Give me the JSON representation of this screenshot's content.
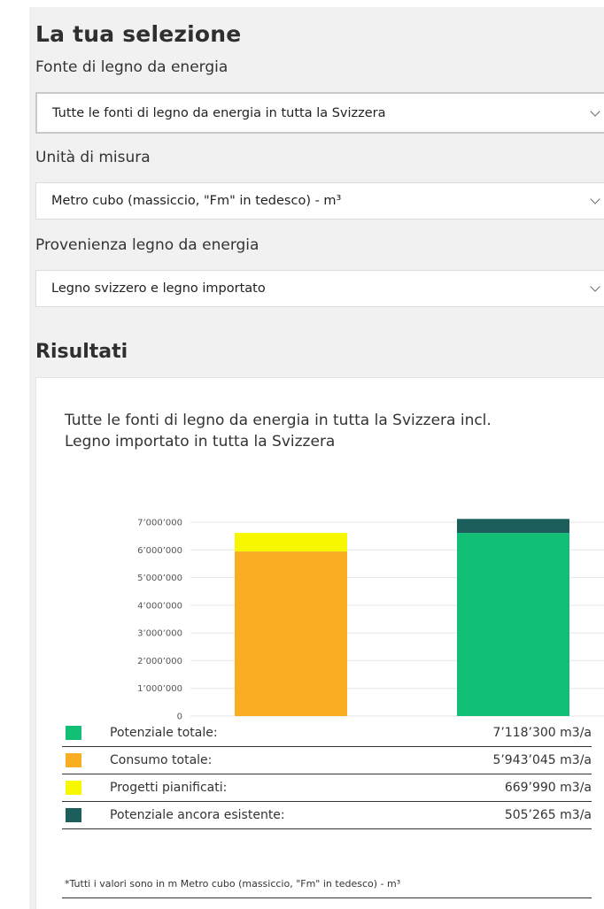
{
  "selection": {
    "title": "La tua selezione",
    "source_label": "Fonte di legno da energia",
    "source_value": "Tutte le fonti di legno da energia in tutta la Svizzera",
    "unit_label": "Unità di misura",
    "unit_value": "Metro cubo (massiccio, \"Fm\" in tedesco) - m³",
    "origin_label": "Provenienza legno da energia",
    "origin_value": "Legno svizzero e legno importato"
  },
  "results": {
    "title": "Risultati",
    "chart_title_line1": "Tutte le fonti di legno da energia in tutta la Svizzera incl.",
    "chart_title_line2": "Legno importato in tutta la Svizzera",
    "legend": [
      {
        "name": "Potenziale totale:",
        "value": "7’118’300 m3/a",
        "color": "#12bf77"
      },
      {
        "name": "Consumo totale:",
        "value": "5’943’045 m3/a",
        "color": "#f9ae21"
      },
      {
        "name": "Progetti pianificati:",
        "value": "669’990 m3/a",
        "color": "#f7f700"
      },
      {
        "name": "Potenziale ancora esistente:",
        "value": "505’265 m3/a",
        "color": "#1b5e5c"
      }
    ],
    "footnote": "*Tutti i valori sono in m Metro cubo (massiccio, \"Fm\" in tedesco) - m³"
  },
  "chart_data": {
    "type": "bar",
    "stacked": true,
    "ylim": [
      0,
      7000000
    ],
    "yticks": [
      "0",
      "1’000’000",
      "2’000’000",
      "3’000’000",
      "4’000’000",
      "5’000’000",
      "6’000’000",
      "7’000’000"
    ],
    "categories": [
      "",
      ""
    ],
    "series": [
      {
        "name": "Consumo totale",
        "color": "#f9ae21",
        "values": [
          5943045,
          0
        ]
      },
      {
        "name": "Progetti pianificati",
        "color": "#f7f700",
        "values": [
          669990,
          0
        ]
      },
      {
        "name": "Potenziale totale",
        "color": "#12bf77",
        "values": [
          0,
          6613035
        ]
      },
      {
        "name": "Potenziale ancora esistente",
        "color": "#1b5e5c",
        "values": [
          0,
          505265
        ]
      }
    ],
    "grid": true
  }
}
